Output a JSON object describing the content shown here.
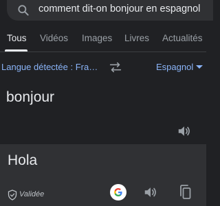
{
  "search": {
    "query": "comment dit-on bonjour en espagnol",
    "icon": "search-icon"
  },
  "tabs": [
    {
      "label": "Tous",
      "active": true
    },
    {
      "label": "Vidéos",
      "active": false
    },
    {
      "label": "Images",
      "active": false
    },
    {
      "label": "Livres",
      "active": false
    },
    {
      "label": "Actualités",
      "active": false
    }
  ],
  "translator": {
    "source_language": "Langue détectée : Fra…",
    "target_language": "Espagnol",
    "source_text": "bonjour",
    "target_text": "Hola",
    "verified_label": "Validée"
  },
  "colors": {
    "background": "#202124",
    "panel": "#303134",
    "accent": "#8ab4f8",
    "text": "#e8eaed",
    "muted": "#9aa0a6"
  }
}
